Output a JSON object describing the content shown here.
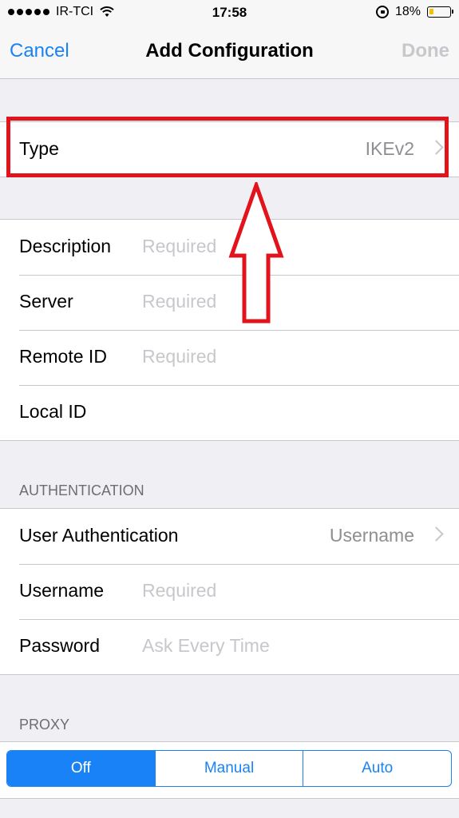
{
  "status_bar": {
    "carrier": "IR-TCI",
    "time": "17:58",
    "battery": "18%",
    "battery_level": 0.18
  },
  "nav": {
    "cancel_label": "Cancel",
    "title": "Add Configuration",
    "done_label": "Done"
  },
  "type_row": {
    "label": "Type",
    "value": "IKEv2"
  },
  "details": [
    {
      "label": "Description",
      "placeholder": "Required"
    },
    {
      "label": "Server",
      "placeholder": "Required"
    },
    {
      "label": "Remote ID",
      "placeholder": "Required"
    },
    {
      "label": "Local ID",
      "placeholder": ""
    }
  ],
  "authentication": {
    "header": "AUTHENTICATION",
    "user_auth_label": "User Authentication",
    "user_auth_value": "Username",
    "username_label": "Username",
    "username_placeholder": "Required",
    "password_label": "Password",
    "password_placeholder": "Ask Every Time"
  },
  "proxy": {
    "header": "PROXY",
    "options": [
      "Off",
      "Manual",
      "Auto"
    ],
    "selected": "Off"
  },
  "colors": {
    "accent": "#1a82f7",
    "annotation": "#e1141c",
    "placeholder": "#c7c7cc"
  }
}
